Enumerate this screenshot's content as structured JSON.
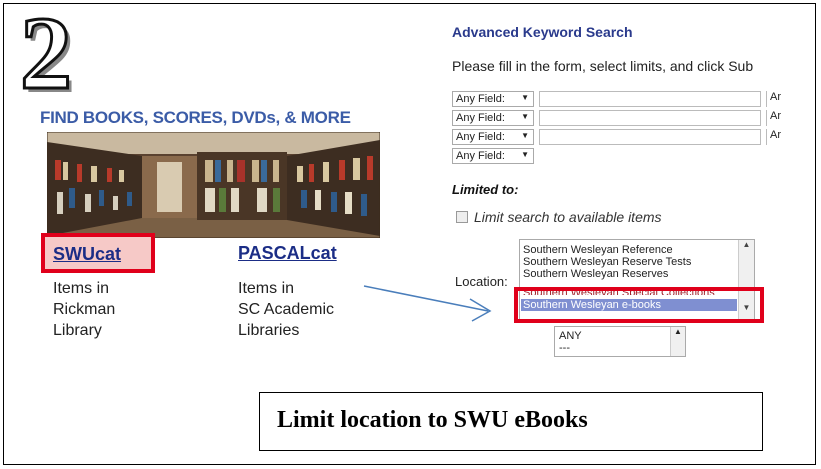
{
  "step_number": "2",
  "library": {
    "heading": "FIND BOOKS, SCORES, DVDs, & MORE",
    "swucat": {
      "label": "SWUcat",
      "desc_lines": [
        "Items in",
        "Rickman",
        "Library"
      ]
    },
    "pascalcat": {
      "label": "PASCALcat",
      "desc_lines": [
        "Items in",
        "SC Academic",
        "Libraries"
      ]
    }
  },
  "search": {
    "title": "Advanced Keyword Search",
    "instructions": "Please fill in the form, select limits, and click Sub",
    "rows": [
      {
        "field": "Any Field:",
        "trail": "Ar"
      },
      {
        "field": "Any Field:",
        "trail": "Ar"
      },
      {
        "field": "Any Field:",
        "trail": "Ar"
      },
      {
        "field": "Any Field:",
        "trail": ""
      }
    ],
    "limited_to": "Limited to:",
    "limit_available": "Limit search to available items",
    "location_label": "Location:",
    "location_options": [
      "Southern Wesleyan Reference",
      "Southern Wesleyan Reserve Tests",
      "Southern Wesleyan Reserves",
      "Southern Wesleyan Special Collections",
      "Southern Wesleyan e-books"
    ],
    "location_selected": "Southern Wesleyan e-books",
    "second_list_options": [
      "ANY",
      "---"
    ]
  },
  "caption": "Limit location to SWU eBooks",
  "colors": {
    "highlight_red": "#e0001b",
    "link_blue": "#1b2d86",
    "heading_blue": "#3b5ca7",
    "arrow_blue": "#4a7ebb",
    "selection_blue": "#7f8fd1"
  }
}
